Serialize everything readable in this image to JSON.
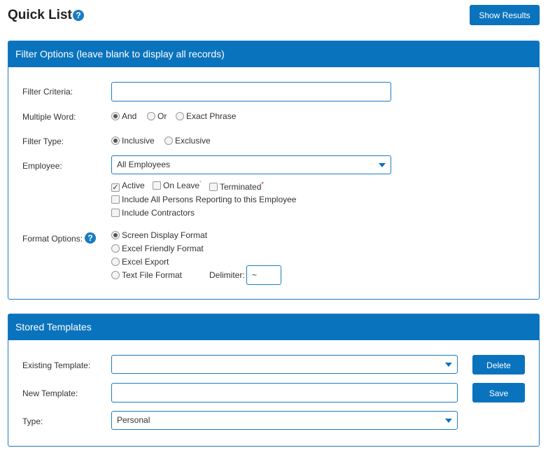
{
  "header": {
    "title": "Quick List",
    "help_icon": "?",
    "show_results_label": "Show Results"
  },
  "filter_panel": {
    "title": "Filter Options (leave blank to display all records)",
    "filter_criteria": {
      "label": "Filter Criteria:",
      "value": ""
    },
    "multiple_word": {
      "label": "Multiple Word:",
      "options": [
        "And",
        "Or",
        "Exact Phrase"
      ],
      "selected": "And"
    },
    "filter_type": {
      "label": "Filter Type:",
      "options": [
        "Inclusive",
        "Exclusive"
      ],
      "selected": "Inclusive"
    },
    "employee": {
      "label": "Employee:",
      "selected": "All Employees",
      "status": {
        "active": {
          "label": "Active",
          "checked": true,
          "check_glyph": "✓"
        },
        "on_leave": {
          "label": "On Leave",
          "checked": false,
          "marker": "*"
        },
        "terminated": {
          "label": "Terminated",
          "checked": false,
          "marker": "*"
        }
      },
      "include_reporting": {
        "label": "Include All Persons Reporting to this Employee",
        "checked": false
      },
      "include_contractors": {
        "label": "Include Contractors",
        "checked": false
      }
    },
    "format_options": {
      "label": "Format Options:",
      "help_icon": "?",
      "options": [
        "Screen Display Format",
        "Excel Friendly Format",
        "Excel Export",
        "Text File Format"
      ],
      "selected": "Screen Display Format",
      "delimiter_label": "Delimiter:",
      "delimiter_value": "~"
    }
  },
  "templates_panel": {
    "title": "Stored Templates",
    "existing_template": {
      "label": "Existing Template:",
      "selected": ""
    },
    "delete_label": "Delete",
    "new_template": {
      "label": "New Template:",
      "value": ""
    },
    "save_label": "Save",
    "type": {
      "label": "Type:",
      "selected": "Personal"
    }
  },
  "colors": {
    "primary": "#0a73bd",
    "border": "#1a7cc2",
    "required_marker": "#d0021b"
  }
}
